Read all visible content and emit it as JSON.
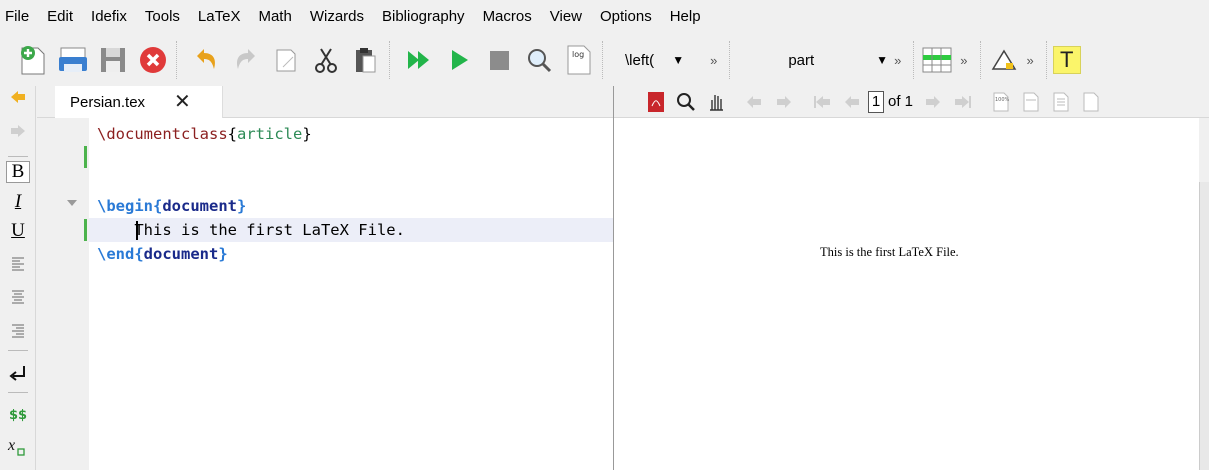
{
  "menu": [
    "File",
    "Edit",
    "Idefix",
    "Tools",
    "LaTeX",
    "Math",
    "Wizards",
    "Bibliography",
    "Macros",
    "View",
    "Options",
    "Help"
  ],
  "toolbar": {
    "left_combo": "\\left(",
    "structure_combo": "part",
    "log_label": "log",
    "more": "»"
  },
  "left_toolbar": {
    "bold": "B",
    "italic": "I",
    "underline": "U",
    "math": "$$"
  },
  "editor": {
    "tab_title": "Persian.tex",
    "tab_close": "✕",
    "lines": {
      "l1_cmd": "\\documentclass",
      "l1_arg": "article",
      "l3_cmd": "\\begin",
      "l3_arg": "document",
      "l4_text": "    This is the first LaTeX File.",
      "l5_cmd": "\\end",
      "l5_arg": "document"
    }
  },
  "pdf": {
    "page_current": "1",
    "page_of": "of 1",
    "content_text": "This is the first LaTeX File."
  }
}
